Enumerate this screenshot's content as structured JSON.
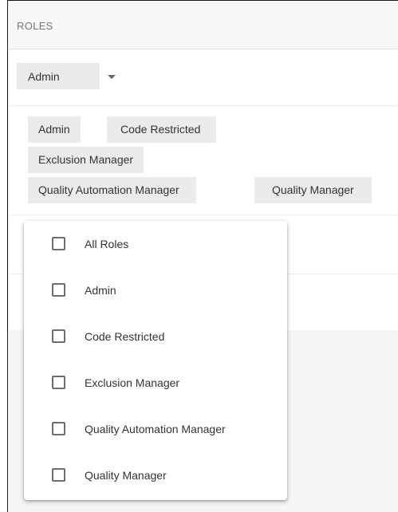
{
  "section": {
    "title": "ROLES"
  },
  "role_select": {
    "selected": "Admin",
    "icon": "chevron-down-icon"
  },
  "selected_tags": [
    "Admin",
    "Code Restricted",
    "Exclusion Manager",
    "Quality Automation Manager",
    "Quality Manager"
  ],
  "menu": {
    "options": [
      {
        "label": "All Roles",
        "checked": false
      },
      {
        "label": "Admin",
        "checked": false
      },
      {
        "label": "Code Restricted",
        "checked": false
      },
      {
        "label": "Exclusion Manager",
        "checked": false
      },
      {
        "label": "Quality Automation Manager",
        "checked": false
      },
      {
        "label": "Quality Manager",
        "checked": false
      }
    ]
  }
}
